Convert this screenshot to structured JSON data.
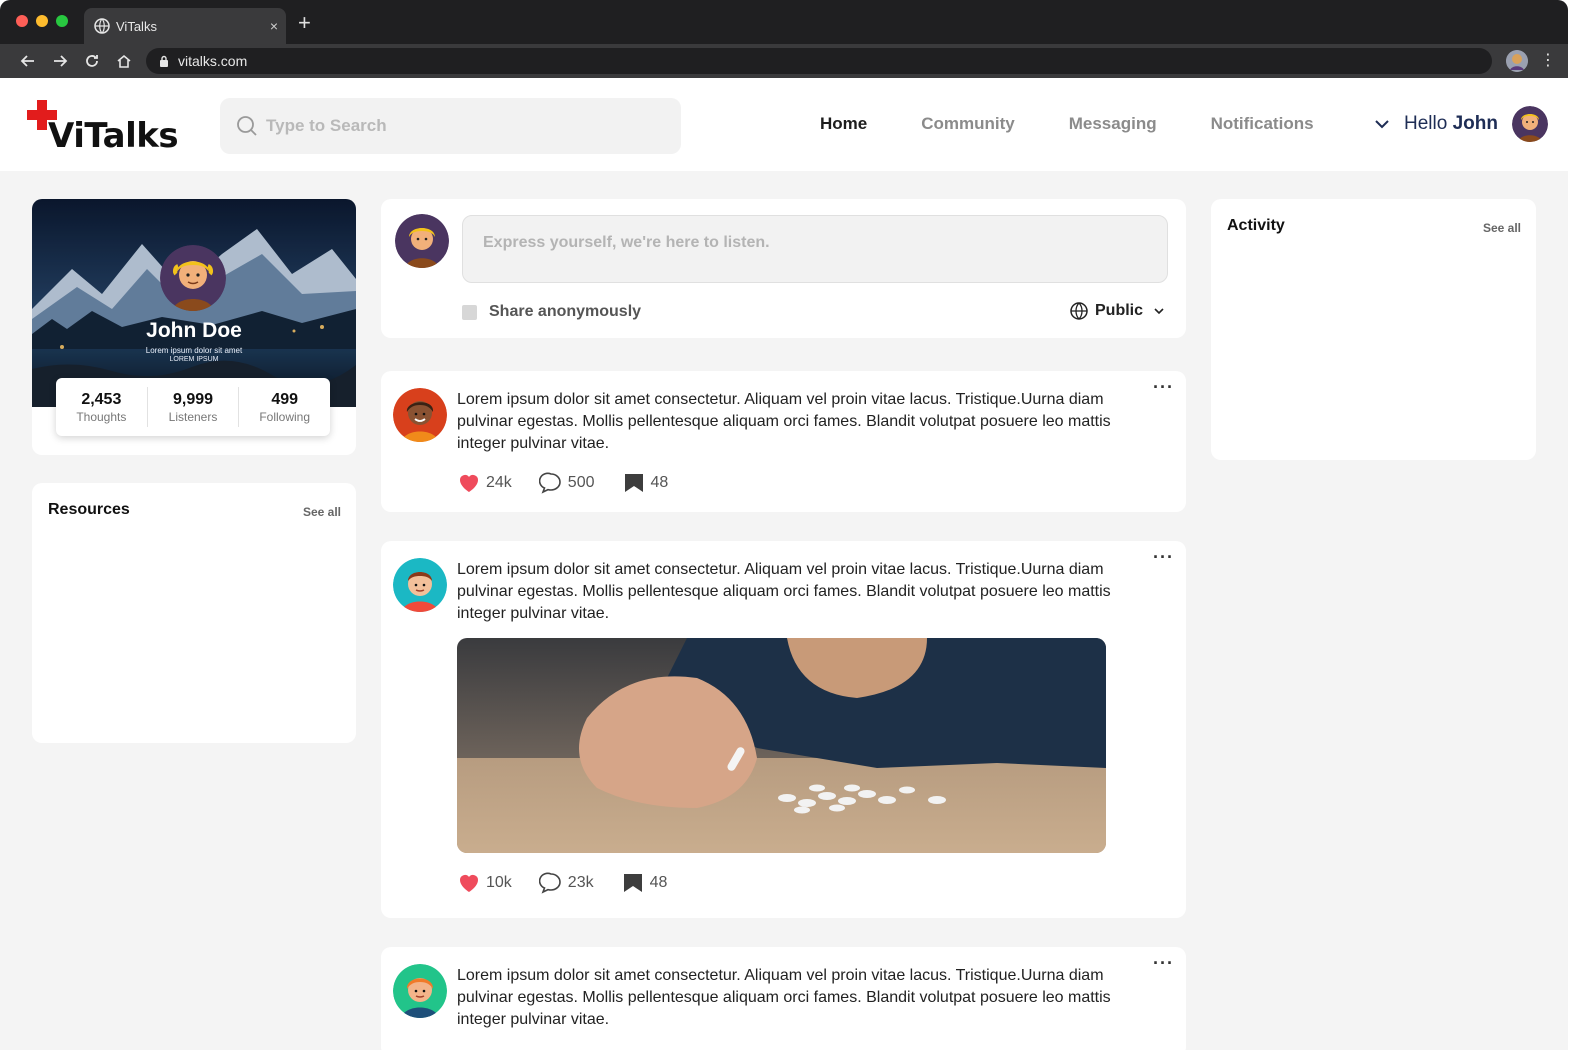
{
  "browser": {
    "tab_title": "ViTalks",
    "tab_close": "×",
    "new_tab": "+",
    "url": "vitalks.com",
    "menu": "⋮"
  },
  "header": {
    "logo": "ViTalks",
    "search_placeholder": "Type to Search",
    "nav": [
      "Home",
      "Community",
      "Messaging",
      "Notifications"
    ],
    "active_nav": "Home",
    "greeting": "Hello",
    "user_first_name": "John"
  },
  "profile": {
    "name": "John Doe",
    "bio": "Lorem ipsum dolor sit amet",
    "tag": "LOREM IPSUM",
    "stats": [
      {
        "value": "2,453",
        "label": "Thoughts"
      },
      {
        "value": "9,999",
        "label": "Listeners"
      },
      {
        "value": "499",
        "label": "Following"
      }
    ]
  },
  "resources": {
    "title": "Resources",
    "see_all": "See all"
  },
  "activity": {
    "title": "Activity",
    "see_all": "See all"
  },
  "composer": {
    "placeholder": "Express yourself, we're here to listen.",
    "anonymous_label": "Share anonymously",
    "privacy": "Public"
  },
  "posts": [
    {
      "text": "Lorem ipsum dolor sit amet consectetur. Aliquam vel proin vitae lacus. Tristique.Uurna diam pulvinar egestas. Mollis pellentesque aliquam orci fames. Blandit volutpat posuere leo mattis integer pulvinar vitae.",
      "likes": "24k",
      "comments": "500",
      "saves": "48",
      "more": "···"
    },
    {
      "text": "Lorem ipsum dolor sit amet consectetur. Aliquam vel proin vitae lacus. Tristique.Uurna diam pulvinar egestas. Mollis pellentesque aliquam orci fames. Blandit volutpat posuere leo mattis integer pulvinar vitae.",
      "likes": "10k",
      "comments": "23k",
      "saves": "48",
      "more": "···"
    },
    {
      "text": "Lorem ipsum dolor sit amet consectetur. Aliquam vel proin vitae lacus. Tristique.Uurna diam pulvinar egestas. Mollis pellentesque aliquam orci fames. Blandit volutpat posuere leo mattis integer pulvinar vitae.",
      "more": "···"
    }
  ],
  "colors": {
    "brand_red": "#e21c1c",
    "heart": "#ef4b5c",
    "nav_active": "#1d1d1d",
    "nav_inactive": "#8b8b8b",
    "greeting_blue": "#1e2d55",
    "page_bg": "#f4f4f4"
  },
  "icons": [
    "globe-icon",
    "close-icon",
    "back-icon",
    "forward-icon",
    "reload-icon",
    "home-icon",
    "lock-icon",
    "search-icon",
    "chevron-down-icon",
    "heart-icon",
    "comment-icon",
    "bookmark-icon",
    "more-icon"
  ]
}
